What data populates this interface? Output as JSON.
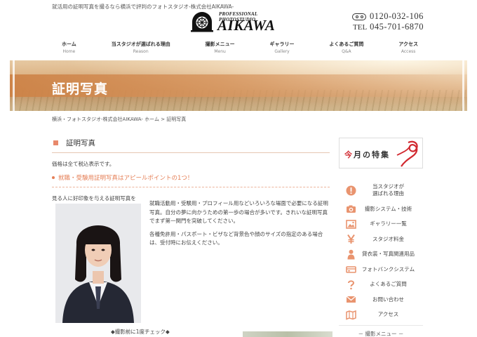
{
  "header": {
    "tagline": "就活用の証明写真を撮るなら横浜で評判のフォトスタジオ-株式会社AIKAWA-",
    "logo_sub": "PROFESSIONAL PHOTOSTUDIO",
    "logo_main": "AIKAWA",
    "free_dial": "0120-032-106",
    "tel_label": "TEL",
    "tel": "045-701-6870"
  },
  "nav": [
    {
      "label": "ホーム",
      "en": "Home"
    },
    {
      "label": "当スタジオが選ばれる理由",
      "en": "Reason"
    },
    {
      "label": "撮影メニュー",
      "en": "Menu"
    },
    {
      "label": "ギャラリー",
      "en": "Gallery"
    },
    {
      "label": "よくあるご質問",
      "en": "Q&A"
    },
    {
      "label": "アクセス",
      "en": "Access"
    }
  ],
  "banner": {
    "title": "証明写真"
  },
  "breadcrumb": "横浜・フォトスタジオ-株式会社AIKAWA- ホーム > 証明写真",
  "main": {
    "heading": "証明写真",
    "price_note": "価格は全て税込表示です。",
    "point": "就職・受験用証明写真はアピールポイントの1つ！",
    "lead": "見る人に好印象を与える証明写真を",
    "paragraph1": "就職活動用・受験用・プロフィール用などいろいろな場面で必要になる証明写真。自分の夢に向かうための第一歩の場合が多いです。きれいな証明写真でまず第一関門を突破してください。",
    "paragraph2": "各種免許用・パスポート・ビザなど背景色や顔のサイズの指定のある場合は、受付時にお伝えください。",
    "caption": "◆撮影前に1度チェック◆"
  },
  "sidebar": {
    "special_prefix": "今",
    "special_rest": "月の特集",
    "menu": [
      {
        "label": "当スタジオが\n選ばれる理由",
        "icon": "exclamation-circle-icon"
      },
      {
        "label": "撮影システム・技術",
        "icon": "camera-icon"
      },
      {
        "label": "ギャラリー一覧",
        "icon": "picture-icon"
      },
      {
        "label": "スタジオ料金",
        "icon": "yen-icon"
      },
      {
        "label": "貸衣装・写真関連用品",
        "icon": "person-icon"
      },
      {
        "label": "フォトバンクシステム",
        "icon": "photo-bank-icon"
      },
      {
        "label": "よくあるご質問",
        "icon": "question-icon"
      },
      {
        "label": "お問い合わせ",
        "icon": "mail-icon"
      },
      {
        "label": "アクセス",
        "icon": "map-icon"
      }
    ],
    "sub_heading": "－ 撮影メニュー －"
  },
  "colors": {
    "accent": "#e8896b",
    "ribbon": "#d1282f",
    "icon": "#e9946f"
  }
}
